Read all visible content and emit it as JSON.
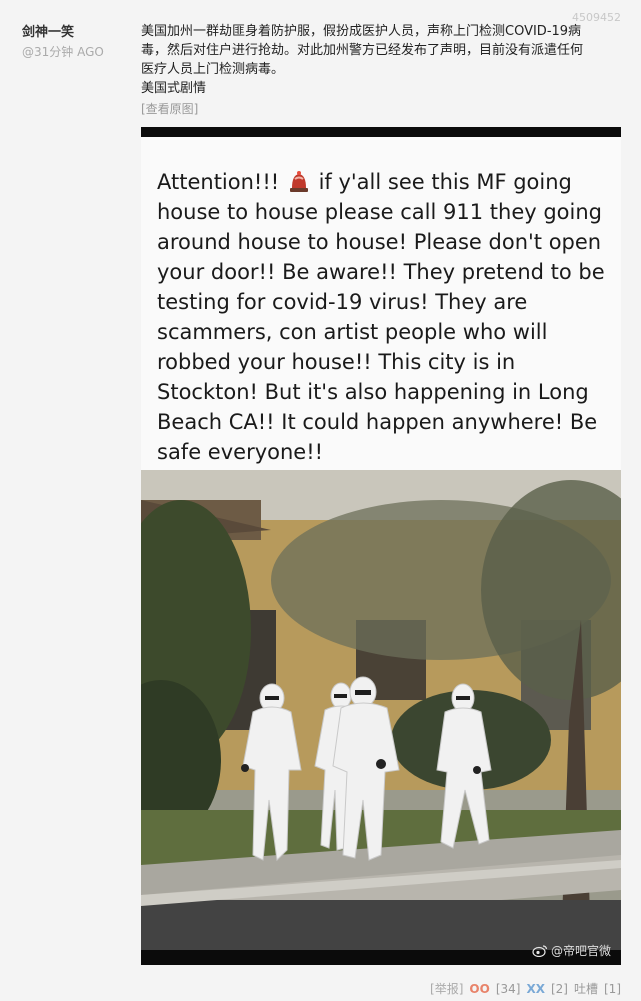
{
  "post": {
    "id": "4509452",
    "author": "剑神一笑",
    "time": "@31分钟 AGO",
    "text_lines": [
      "美国加州一群劫匪身着防护服，假扮成医护人员，声称上门检测COVID-19病",
      "毒，然后对住户进行抢劫。对此加州警方已经发布了声明，目前没有派遣任何",
      "医疗人员上门检测病毒。",
      "美国式剧情"
    ],
    "view_original": "[查看原图]"
  },
  "image": {
    "caption_part1": "Attention!!!",
    "caption_part2": "if y'all see this MF going house to house please call 911 they going around house to house! Please don't open your door!! Be aware!! They pretend to be testing for covid-19 virus! They are scammers, con artist people who will robbed your house!! This city is in Stockton! But it's also happening in Long Beach CA!! It could happen anywhere! Be safe everyone!!",
    "watermark": "@帝吧官微",
    "icon": "weibo-icon"
  },
  "footer": {
    "report": "[举报]",
    "oo_label": "OO",
    "oo_count": "[34]",
    "xx_label": "XX",
    "xx_count": "[2]",
    "tucao_label": "吐槽",
    "tucao_count": "[1]"
  },
  "colors": {
    "oo": "#e8836a",
    "xx": "#7aa9d6",
    "background": "#f4f4f4"
  }
}
